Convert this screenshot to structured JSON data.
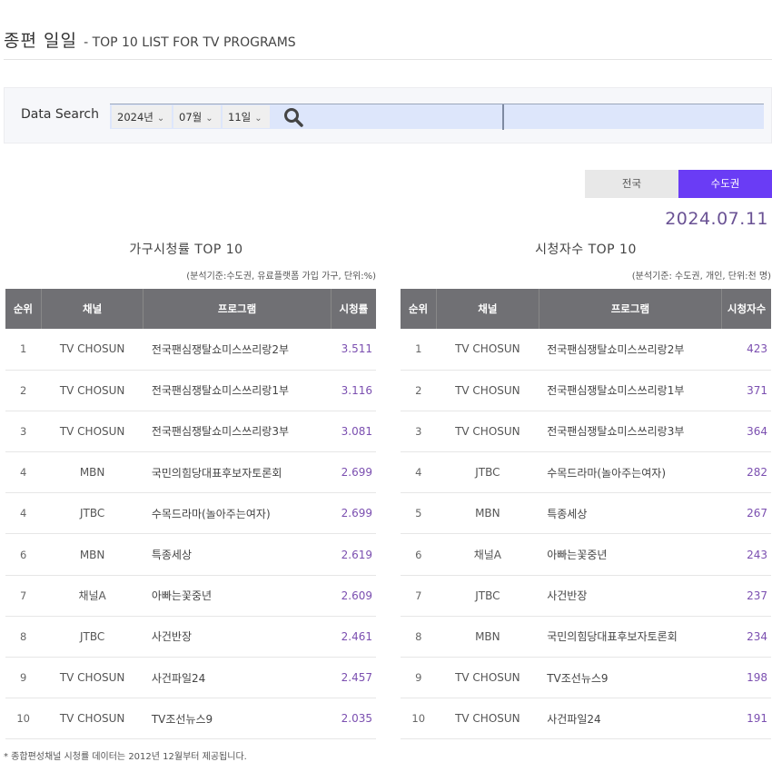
{
  "header": {
    "title_ko": "종편 일일",
    "title_en": "- TOP 10 LIST FOR TV PROGRAMS"
  },
  "search": {
    "label": "Data Search",
    "year": "2024년",
    "month": "07월",
    "day": "11일",
    "search_icon": "search-icon"
  },
  "region_tabs": [
    {
      "label": "전국",
      "active": false
    },
    {
      "label": "수도권",
      "active": true
    }
  ],
  "date": "2024.07.11",
  "colors": {
    "accent": "#6a3cf5",
    "value_text": "#7b4fb0",
    "table_header": "#707074",
    "date_text": "#6a5294"
  },
  "household_rating": {
    "title": "가구시청률 TOP 10",
    "note": "(분석기준:수도권, 유료플랫폼 가입 가구, 단위:%)",
    "columns": [
      "순위",
      "채널",
      "프로그램",
      "시청률"
    ],
    "rows": [
      {
        "rank": "1",
        "channel": "TV CHOSUN",
        "program": "전국팬심쟁탈쇼미스쓰리랑2부",
        "value": "3.511"
      },
      {
        "rank": "2",
        "channel": "TV CHOSUN",
        "program": "전국팬심쟁탈쇼미스쓰리랑1부",
        "value": "3.116"
      },
      {
        "rank": "3",
        "channel": "TV CHOSUN",
        "program": "전국팬심쟁탈쇼미스쓰리랑3부",
        "value": "3.081"
      },
      {
        "rank": "4",
        "channel": "MBN",
        "program": "국민의힘당대표후보자토론회",
        "value": "2.699"
      },
      {
        "rank": "4",
        "channel": "JTBC",
        "program": "수목드라마(놀아주는여자)",
        "value": "2.699"
      },
      {
        "rank": "6",
        "channel": "MBN",
        "program": "특종세상",
        "value": "2.619"
      },
      {
        "rank": "7",
        "channel": "채널A",
        "program": "아빠는꽃중년",
        "value": "2.609"
      },
      {
        "rank": "8",
        "channel": "JTBC",
        "program": "사건반장",
        "value": "2.461"
      },
      {
        "rank": "9",
        "channel": "TV CHOSUN",
        "program": "사건파일24",
        "value": "2.457"
      },
      {
        "rank": "10",
        "channel": "TV CHOSUN",
        "program": "TV조선뉴스9",
        "value": "2.035"
      }
    ]
  },
  "viewers": {
    "title": "시청자수 TOP 10",
    "note": "(분석기준: 수도권, 개인, 단위:천 명)",
    "columns": [
      "순위",
      "채널",
      "프로그램",
      "시청자수"
    ],
    "rows": [
      {
        "rank": "1",
        "channel": "TV CHOSUN",
        "program": "전국팬심쟁탈쇼미스쓰리랑2부",
        "value": "423"
      },
      {
        "rank": "2",
        "channel": "TV CHOSUN",
        "program": "전국팬심쟁탈쇼미스쓰리랑1부",
        "value": "371"
      },
      {
        "rank": "3",
        "channel": "TV CHOSUN",
        "program": "전국팬심쟁탈쇼미스쓰리랑3부",
        "value": "364"
      },
      {
        "rank": "4",
        "channel": "JTBC",
        "program": "수목드라마(놀아주는여자)",
        "value": "282"
      },
      {
        "rank": "5",
        "channel": "MBN",
        "program": "특종세상",
        "value": "267"
      },
      {
        "rank": "6",
        "channel": "채널A",
        "program": "아빠는꽃중년",
        "value": "243"
      },
      {
        "rank": "7",
        "channel": "JTBC",
        "program": "사건반장",
        "value": "237"
      },
      {
        "rank": "8",
        "channel": "MBN",
        "program": "국민의힘당대표후보자토론회",
        "value": "234"
      },
      {
        "rank": "9",
        "channel": "TV CHOSUN",
        "program": "TV조선뉴스9",
        "value": "198"
      },
      {
        "rank": "10",
        "channel": "TV CHOSUN",
        "program": "사건파일24",
        "value": "191"
      }
    ]
  },
  "footnote": "* 종합편성채널 시청률 데이터는 2012년 12월부터 제공됩니다."
}
